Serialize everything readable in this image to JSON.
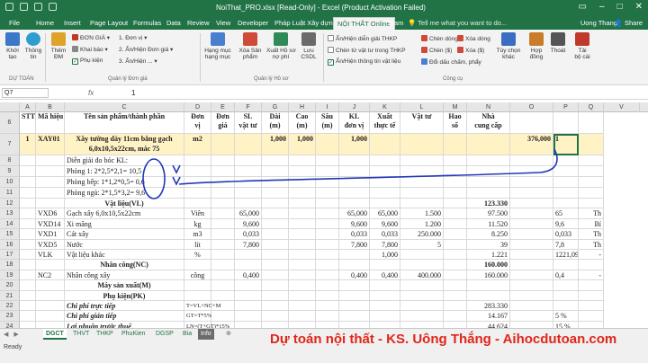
{
  "window": {
    "title": "NoiThat_PRO.xlsx [Read-Only] - Excel (Product Activation Failed)",
    "user": "Uong Thang",
    "share": "Share"
  },
  "tabs": [
    "File",
    "Home",
    "Insert",
    "Page Layout",
    "Formulas",
    "Data",
    "Review",
    "View",
    "Developer",
    "Pháp Luật Xây dựng",
    "NỘI THẤT Online",
    "Team"
  ],
  "tell_me": "Tell me what you want to do...",
  "ribbon": {
    "khoi_tao": "Khởi\ntạo",
    "thong_tin": "Thông\ntin",
    "them_dm": "Thêm\nĐM",
    "don_gia": "ĐƠN GIÁ",
    "khai_bao": "Khai báo",
    "phu_kien": "Phụ kiện",
    "dongia1": "1. Đơn vị",
    "dongia2": "2. Ẩn/Hiện Đơn giá",
    "dongia3": "3. Ẩn/Hiện ...",
    "hang_muc": "Hạng mục\nhạng mục",
    "xoa_san_pham": "Xóa Sản\nphẩm",
    "xuat_ho_so": "Xuất Hồ sơ\nnợ phí",
    "luu_csdl": "Lưu\nCSDL",
    "an_hien_giai": "Ẩn/Hiện diễn giải THKP",
    "chen_tu_thkp": "Chèn từ vật tư trong THKP",
    "an_hien_tt": "Ẩn/Hiện thông tin vật liệu",
    "chen_dong": "Chèn dòng",
    "chen_so": "Chèn ($)",
    "doi_dau": "Đổi dấu chấm, phẩy",
    "xoa_dong": "Xóa dòng",
    "xoa_dau": "Xóa ($)",
    "tuy_chon": "Tùy chọn\nkhác",
    "hop_dong": "Hợp\nđồng",
    "thoat": "Thoát",
    "tai_bo_cai": "Tải\nbộ cài",
    "groups": [
      "DỰ TOÁN",
      "Quản lý Đơn giá",
      "Quản lý Hồ sơ",
      "Công cụ"
    ]
  },
  "formula": {
    "name_box": "Q7",
    "fx": "fx",
    "value": "1"
  },
  "columns": [
    "A",
    "B",
    "C",
    "D",
    "E",
    "F",
    "G",
    "H",
    "I",
    "J",
    "K",
    "L",
    "M",
    "N",
    "O",
    "P",
    "Q",
    "V"
  ],
  "rows": [
    {
      "n": "6",
      "cells": [
        "STT",
        "Mã hiệu",
        "Tên sản phẩm/thành phần",
        "Đơn\nvị",
        "Đơn\ngiá",
        "SL\nvật tư",
        "Dài\n(m)",
        "Cao\n(m)",
        "Sâu\n(m)",
        "KL\nđơn vị",
        "Xuất\nthực tế",
        "Vật tư",
        "Hao\nsố",
        "Nhà\ncung cấp",
        "",
        "",
        ""
      ]
    },
    {
      "n": "7",
      "cells": [
        "1",
        "XAY01",
        "Xây tường dày 11cm bằng gạch 6,0x10,5x22cm, mác 75",
        "m2",
        "",
        "",
        "1,000",
        "1,000",
        "",
        "1,000",
        "",
        "",
        "",
        "",
        "376,000",
        "1",
        ""
      ]
    },
    {
      "n": "8",
      "cells": [
        "",
        "",
        "Diễn giải đo bóc KL:",
        "",
        "",
        "",
        "",
        "",
        "",
        "",
        "",
        "",
        "",
        "",
        "",
        "",
        ""
      ]
    },
    {
      "n": "9",
      "cells": [
        "",
        "",
        "Phòng 1: 2*2,5*2,1= 10,5",
        "",
        "",
        "",
        "",
        "",
        "",
        "",
        "",
        "",
        "",
        "",
        "",
        "",
        ""
      ]
    },
    {
      "n": "10",
      "cells": [
        "",
        "",
        "Phòng bếp: 1*1,2*0,5= 0,6",
        "",
        "",
        "",
        "",
        "",
        "",
        "",
        "",
        "",
        "",
        "",
        "",
        "",
        ""
      ]
    },
    {
      "n": "11",
      "cells": [
        "",
        "",
        "Phòng ngủ: 2*1,5*3,2= 9,6",
        "",
        "",
        "",
        "",
        "",
        "",
        "",
        "",
        "",
        "",
        "",
        "",
        "",
        ""
      ]
    },
    {
      "n": "12",
      "cells": [
        "",
        "",
        "Vật liệu(VL)",
        "",
        "",
        "",
        "",
        "",
        "",
        "",
        "",
        "",
        "",
        "123.330",
        "",
        "",
        ""
      ]
    },
    {
      "n": "13",
      "cells": [
        "",
        "VXD6",
        "Gạch xây 6,0x10,5x22cm",
        "Viên",
        "",
        "65,000",
        "",
        "",
        "",
        "65,000",
        "65,000",
        "1.500",
        "",
        "97.500",
        "",
        "65",
        "Th"
      ]
    },
    {
      "n": "14",
      "cells": [
        "",
        "VXD14",
        "Xi măng",
        "kg",
        "",
        "9,600",
        "",
        "",
        "",
        "9,600",
        "9,600",
        "1.200",
        "",
        "11.520",
        "",
        "9,6",
        "Bí"
      ]
    },
    {
      "n": "15",
      "cells": [
        "",
        "VXD1",
        "Cát xây",
        "m3",
        "",
        "0,033",
        "",
        "",
        "",
        "0,033",
        "0,033",
        "250.000",
        "",
        "8.250",
        "",
        "0,033",
        "Th"
      ]
    },
    {
      "n": "16",
      "cells": [
        "",
        "VXD5",
        "Nước",
        "lít",
        "",
        "7,800",
        "",
        "",
        "",
        "7,800",
        "7,800",
        "5",
        "",
        "39",
        "",
        "7,8",
        "Th"
      ]
    },
    {
      "n": "17",
      "cells": [
        "",
        "VLK",
        "Vật liệu khác",
        "%",
        "",
        "",
        "",
        "",
        "",
        "",
        "1,000",
        "",
        "",
        "1.221",
        "",
        "1221,09",
        "-"
      ]
    },
    {
      "n": "18",
      "cells": [
        "",
        "",
        "Nhân công(NC)",
        "",
        "",
        "",
        "",
        "",
        "",
        "",
        "",
        "",
        "",
        "160.000",
        "",
        "",
        ""
      ]
    },
    {
      "n": "19",
      "cells": [
        "",
        "NC2",
        "Nhân công xây",
        "công",
        "",
        "0,400",
        "",
        "",
        "",
        "0,400",
        "0,400",
        "400.000",
        "",
        "160.000",
        "",
        "0,4",
        "-"
      ]
    },
    {
      "n": "20",
      "cells": [
        "",
        "",
        "Máy sản xuất(M)",
        "",
        "",
        "",
        "",
        "",
        "",
        "",
        "",
        "",
        "",
        "",
        "",
        "",
        ""
      ]
    },
    {
      "n": "21",
      "cells": [
        "",
        "",
        "Phụ kiện(PK)",
        "",
        "",
        "",
        "",
        "",
        "",
        "",
        "",
        "",
        "",
        "",
        "",
        "",
        ""
      ]
    },
    {
      "n": "22",
      "cells": [
        "",
        "",
        "Chi phí trực tiếp",
        "T=VL+NC+M",
        "",
        "",
        "",
        "",
        "",
        "",
        "",
        "",
        "",
        "283.330",
        "",
        "",
        ""
      ]
    },
    {
      "n": "23",
      "cells": [
        "",
        "",
        "Chi phí gián tiếp",
        "GT=T*5%",
        "",
        "",
        "",
        "",
        "",
        "",
        "",
        "",
        "",
        "14.167",
        "",
        "5 %",
        ""
      ]
    },
    {
      "n": "24",
      "cells": [
        "",
        "",
        "Lợi nhuận trước thuế",
        "LN=(T+GT)*15%",
        "",
        "",
        "",
        "",
        "",
        "",
        "",
        "",
        "",
        "44.624",
        "",
        "15 %",
        ""
      ]
    }
  ],
  "sheets": [
    "DGCT",
    "THVT",
    "THKP",
    "PhuKien",
    "DGSP",
    "Bia",
    "Info"
  ],
  "status": "Ready",
  "footer_caption": "Dự toán nội thất - KS. Uông Thắng - Aihocdutoan.com",
  "colors": {
    "excel_green": "#217346",
    "highlight_row": "#fff2c4",
    "footer_red": "#e0261b",
    "annotation_blue": "#2438b8"
  }
}
